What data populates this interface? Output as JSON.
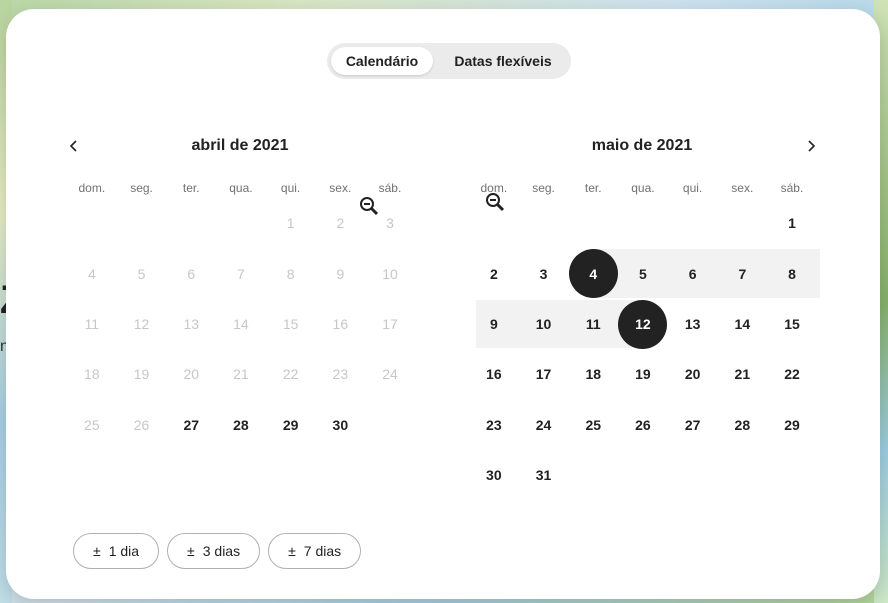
{
  "background": {
    "edge_text": "Z",
    "edge_small_text": "n"
  },
  "toggle": {
    "active_label": "Calendário",
    "inactive_label": "Datas flexíveis"
  },
  "weekdays": [
    "dom.",
    "seg.",
    "ter.",
    "qua.",
    "qui.",
    "sex.",
    "sáb."
  ],
  "months": [
    {
      "title": "abril de 2021",
      "first_weekday_index": 4,
      "days_in_month": 30,
      "disabled_through": 26
    },
    {
      "title": "maio de 2021",
      "first_weekday_index": 6,
      "days_in_month": 31,
      "disabled_through": 0,
      "selected_start": 4,
      "selected_end": 12
    }
  ],
  "flex_chips": [
    {
      "symbol": "±",
      "label": "1 dia"
    },
    {
      "symbol": "±",
      "label": "3 dias"
    },
    {
      "symbol": "±",
      "label": "7 dias"
    }
  ],
  "icons": {
    "prev": "chevron-left-icon",
    "next": "chevron-right-icon",
    "cursor": "zoom-out-cursor-icon"
  }
}
